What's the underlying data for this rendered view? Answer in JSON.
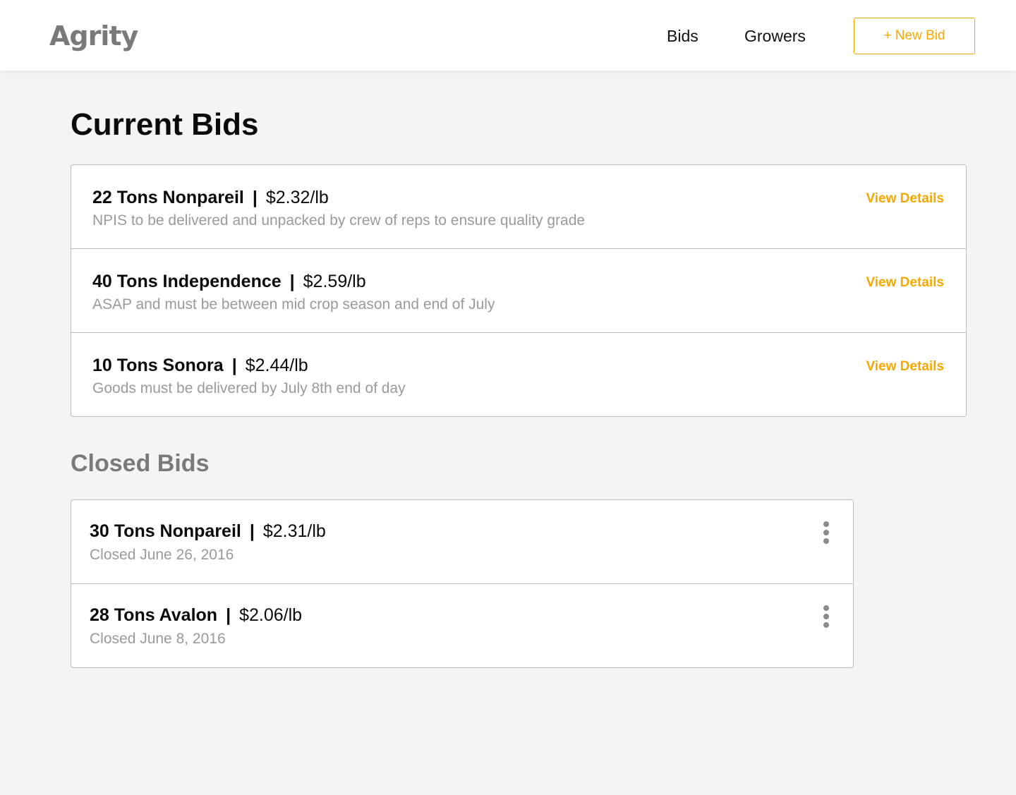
{
  "app": {
    "logo": "Agrity"
  },
  "nav": {
    "bids": "Bids",
    "growers": "Growers",
    "new_bid": "+ New Bid"
  },
  "current": {
    "title": "Current Bids",
    "view_label": "View Details",
    "items": [
      {
        "name": "22 Tons Nonpareil",
        "price": "$2.32/lb",
        "note": "NPIS to be delivered and unpacked by crew of reps to ensure quality grade"
      },
      {
        "name": "40 Tons Independence",
        "price": "$2.59/lb",
        "note": "ASAP and must be between mid crop season and end of July"
      },
      {
        "name": "10 Tons Sonora",
        "price": "$2.44/lb",
        "note": "Goods must be delivered by July 8th end of day"
      }
    ]
  },
  "closed": {
    "title": "Closed Bids",
    "items": [
      {
        "name": "30 Tons Nonpareil",
        "price": "$2.31/lb",
        "note": "Closed June 26, 2016"
      },
      {
        "name": "28 Tons Avalon",
        "price": "$2.06/lb",
        "note": "Closed June 8, 2016"
      }
    ]
  },
  "separator": "|",
  "icons": {
    "more": "more-vertical-icon"
  },
  "colors": {
    "accent": "#f5a800",
    "background": "#f4f4f4",
    "muted_text": "#9a9a9a",
    "logo": "#7a7a7a"
  }
}
